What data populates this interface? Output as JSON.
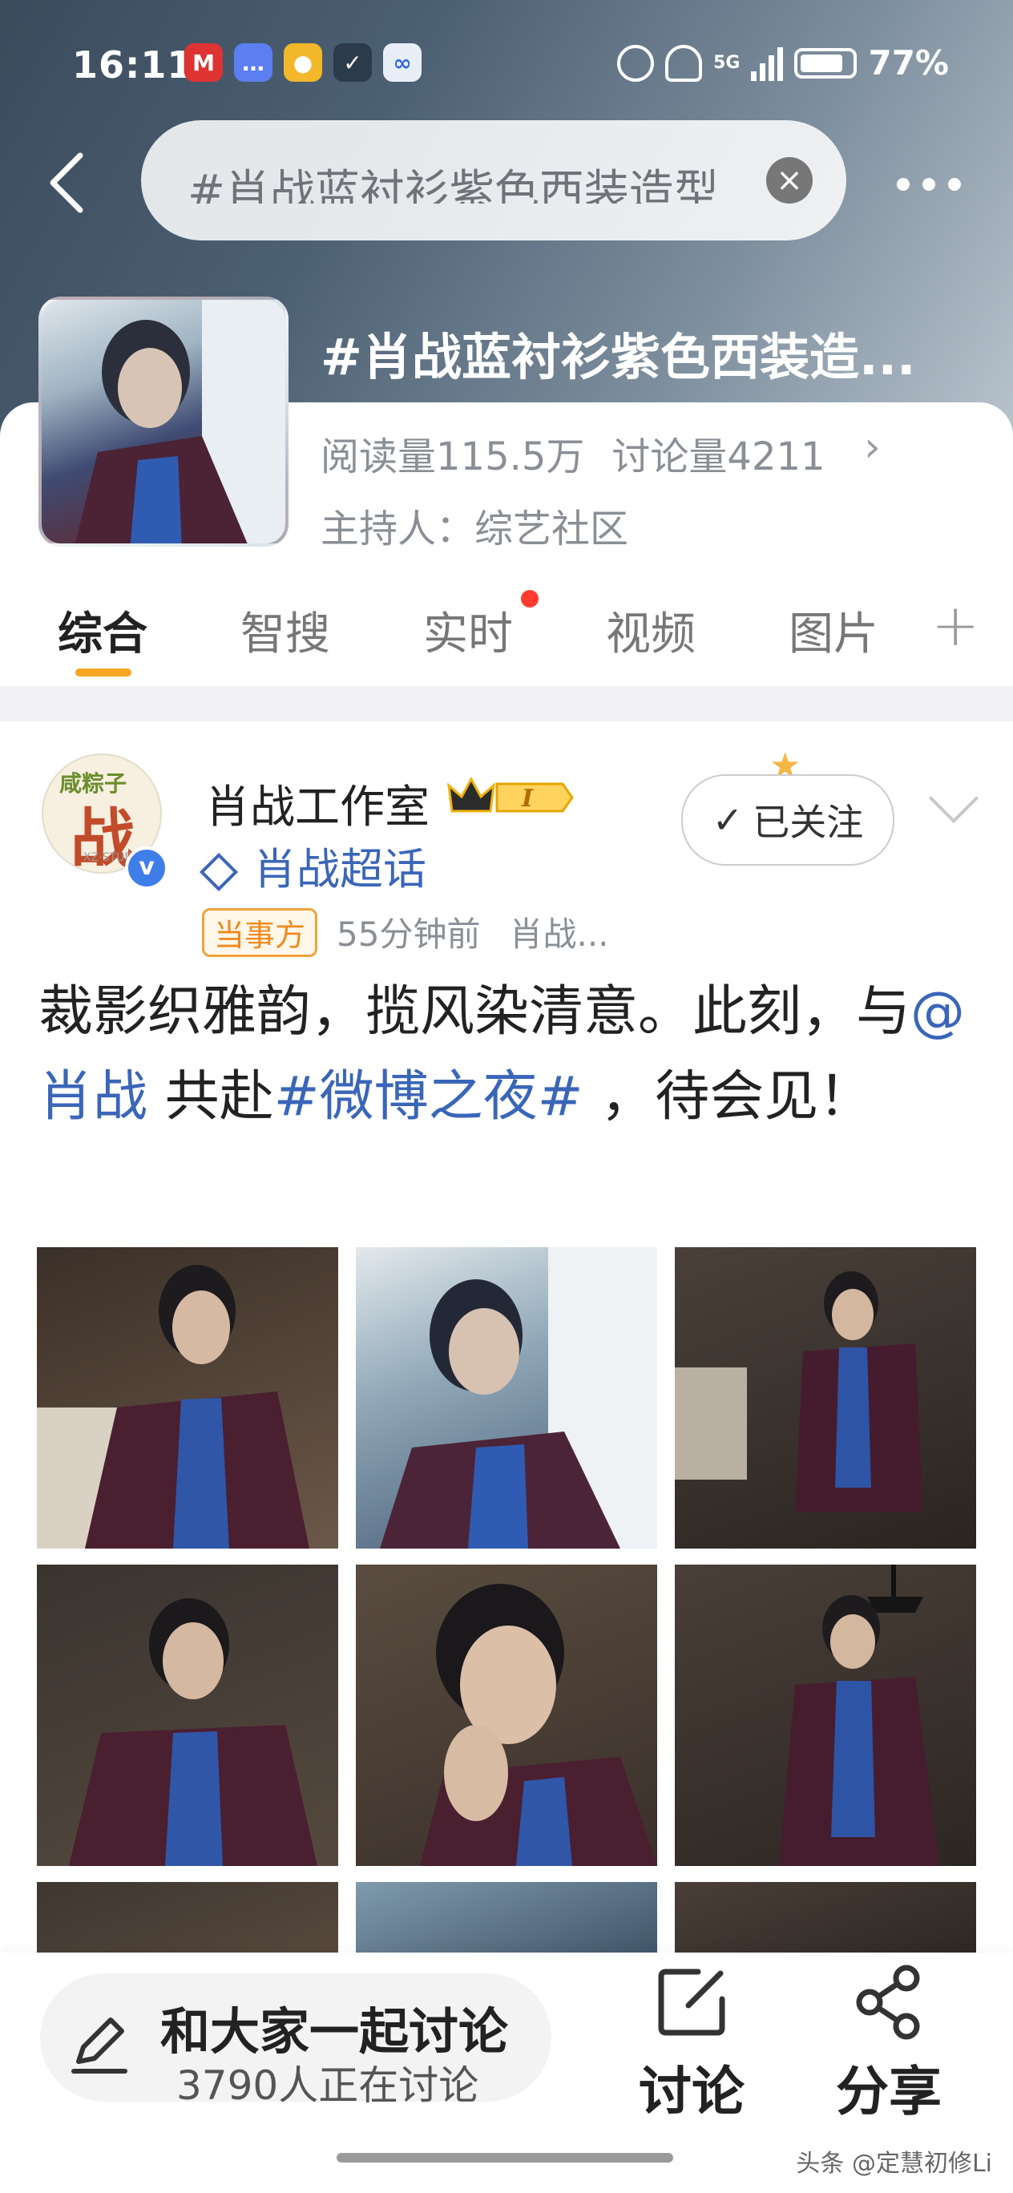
{
  "status_bar": {
    "time": "16:11",
    "network": "5G",
    "battery": "77%"
  },
  "search": {
    "query": "#肖战蓝衬衫紫色西装造型"
  },
  "topic": {
    "title": "#肖战蓝衬衫紫色西装造...",
    "reads": "阅读量115.5万",
    "discussions": "讨论量4211",
    "host": "主持人：综艺社区"
  },
  "tabs": [
    {
      "label": "综合"
    },
    {
      "label": "智搜"
    },
    {
      "label": "实时"
    },
    {
      "label": "视频"
    },
    {
      "label": "图片"
    }
  ],
  "post": {
    "avatar_text_top": "咸粽子",
    "avatar_text_main": "战",
    "avatar_text_sub": "XZ·STUDIO",
    "author": "肖战工作室",
    "level_badge": "I",
    "super_topic": "肖战超话",
    "party_badge": "当事方",
    "time": "55分钟前",
    "source": "肖战...",
    "follow_label": "已关注",
    "text_part1": "裁影织雅韵，揽风染清意。此刻，与",
    "mention": "@肖战",
    "text_part2": " 共赴",
    "hashtag": "#微博之夜#",
    "text_part3": " ，待会见！",
    "images_count": 9
  },
  "bottom": {
    "discuss_title": "和大家一起讨论",
    "discuss_sub": "3790人正在讨论",
    "discuss_label": "讨论",
    "share_label": "分享"
  },
  "watermark": "头条 @定慧初修Li",
  "colors": {
    "accent": "#f5a623",
    "link": "#3a66b8",
    "red_dot": "#ff3b30",
    "verified": "#3f7ee8"
  }
}
